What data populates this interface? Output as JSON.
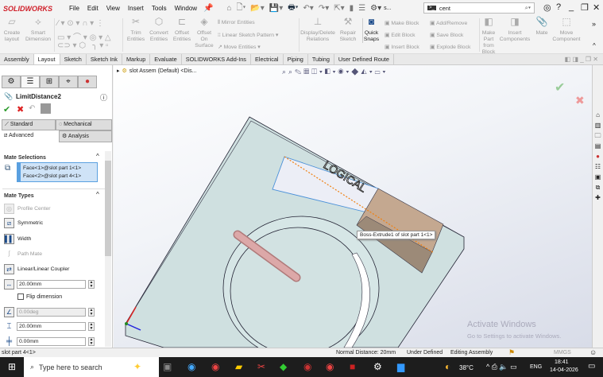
{
  "app": {
    "logo": "SOLIDWORKS",
    "menu": [
      "File",
      "Edit",
      "View",
      "Insert",
      "Tools",
      "Window"
    ],
    "search_value": "cent",
    "search_prefix": "s..."
  },
  "command_manager": {
    "left": [
      {
        "label": "Create layout"
      },
      {
        "label": "Smart Dimension"
      }
    ],
    "entities": [
      {
        "label": "Trim Entities"
      },
      {
        "label": "Convert Entities"
      },
      {
        "label": "Offset Entities"
      },
      {
        "label": "Offset On Surface"
      }
    ],
    "rows1": [
      "Mirror Entities",
      "Linear Sketch Pattern",
      "Move Entities"
    ],
    "mid": [
      {
        "label": "Display/Delete Relations"
      },
      {
        "label": "Repair Sketch"
      },
      {
        "label": "Quick Snaps"
      }
    ],
    "block1": [
      "Make Block",
      "Edit Block",
      "Insert Block"
    ],
    "block2": [
      "Add/Remove",
      "Save Block",
      "Explode Block"
    ],
    "right": [
      {
        "label": "Make Part from Block"
      },
      {
        "label": "Insert Components"
      },
      {
        "label": "Mate"
      },
      {
        "label": "Move Component"
      }
    ]
  },
  "tabs": [
    "Assembly",
    "Layout",
    "Sketch",
    "Sketch Ink",
    "Markup",
    "Evaluate",
    "SOLIDWORKS Add-Ins",
    "Electrical",
    "Piping",
    "Tubing",
    "User Defined Route"
  ],
  "active_tab": "Layout",
  "property_manager": {
    "title": "LimitDistance2",
    "mate_tabs": [
      "Standard",
      "Mechanical",
      "Advanced",
      "Analysis"
    ],
    "mate_selections_label": "Mate Selections",
    "selections": [
      "Face<1>@slot part 1<1>",
      "Face<2>@slot part 4<1>"
    ],
    "mate_types_label": "Mate Types",
    "types": [
      "Profile Center",
      "Symmetric",
      "Width",
      "Path Mate",
      "Linear/Linear Coupler"
    ],
    "distance": "20.00mm",
    "flip_label": "Flip dimension",
    "angle": "0.00deg",
    "max": "20.00mm",
    "min": "0.00mm"
  },
  "viewport": {
    "tree_item": "slot Assem (Default) <Dis...",
    "engraving": "LOGICAL",
    "tooltip": "Boss-Extrude1 of slot part 1<1>",
    "watermark_title": "Activate Windows",
    "watermark_sub": "Go to Settings to activate Windows."
  },
  "status": {
    "left": "slot part 4<1>",
    "distance": "Normal Distance: 20mm",
    "defined": "Under Defined",
    "mode": "Editing Assembly",
    "units": "MMGS"
  },
  "taskbar": {
    "search_placeholder": "Type here to search",
    "weather": "38°C",
    "lang": "ENG",
    "time": "18:41",
    "date": "14-04-2026"
  }
}
